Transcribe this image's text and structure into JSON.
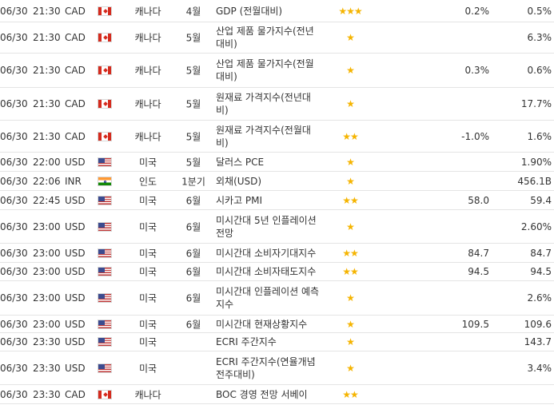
{
  "rows": [
    {
      "date": "06/30",
      "time": "21:30",
      "currency": "CAD",
      "flag": "ca",
      "country": "캐나다",
      "period": "4월",
      "event": "GDP (전월대비)",
      "importance": "★★★",
      "previous": "0.2%",
      "actual": "0.5%"
    },
    {
      "date": "06/30",
      "time": "21:30",
      "currency": "CAD",
      "flag": "ca",
      "country": "캐나다",
      "period": "5월",
      "event": "산업 제품 물가지수(전년대비)",
      "importance": "★",
      "previous": "",
      "actual": "6.3%"
    },
    {
      "date": "06/30",
      "time": "21:30",
      "currency": "CAD",
      "flag": "ca",
      "country": "캐나다",
      "period": "5월",
      "event": "산업 제품 물가지수(전월대비)",
      "importance": "★",
      "previous": "0.3%",
      "actual": "0.6%"
    },
    {
      "date": "06/30",
      "time": "21:30",
      "currency": "CAD",
      "flag": "ca",
      "country": "캐나다",
      "period": "5월",
      "event": "원재료 가격지수(전년대비)",
      "importance": "★",
      "previous": "",
      "actual": "17.7%"
    },
    {
      "date": "06/30",
      "time": "21:30",
      "currency": "CAD",
      "flag": "ca",
      "country": "캐나다",
      "period": "5월",
      "event": "원재료 가격지수(전월대비)",
      "importance": "★★",
      "previous": "-1.0%",
      "actual": "1.6%"
    },
    {
      "date": "06/30",
      "time": "22:00",
      "currency": "USD",
      "flag": "us",
      "country": "미국",
      "period": "5월",
      "event": "달러스 PCE",
      "importance": "★",
      "previous": "",
      "actual": "1.90%"
    },
    {
      "date": "06/30",
      "time": "22:06",
      "currency": "INR",
      "flag": "in",
      "country": "인도",
      "period": "1분기",
      "event": "외채(USD)",
      "importance": "★",
      "previous": "",
      "actual": "456.1B"
    },
    {
      "date": "06/30",
      "time": "22:45",
      "currency": "USD",
      "flag": "us",
      "country": "미국",
      "period": "6월",
      "event": "시카고 PMI",
      "importance": "★★",
      "previous": "58.0",
      "actual": "59.4"
    },
    {
      "date": "06/30",
      "time": "23:00",
      "currency": "USD",
      "flag": "us",
      "country": "미국",
      "period": "6월",
      "event": "미시간대 5년 인플레이션 전망",
      "importance": "★",
      "previous": "",
      "actual": "2.60%"
    },
    {
      "date": "06/30",
      "time": "23:00",
      "currency": "USD",
      "flag": "us",
      "country": "미국",
      "period": "6월",
      "event": "미시간대 소비자기대지수",
      "importance": "★★",
      "previous": "84.7",
      "actual": "84.7"
    },
    {
      "date": "06/30",
      "time": "23:00",
      "currency": "USD",
      "flag": "us",
      "country": "미국",
      "period": "6월",
      "event": "미시간대 소비자태도지수",
      "importance": "★★",
      "previous": "94.5",
      "actual": "94.5"
    },
    {
      "date": "06/30",
      "time": "23:00",
      "currency": "USD",
      "flag": "us",
      "country": "미국",
      "period": "6월",
      "event": "미시간대 인플레이션 예측지수",
      "importance": "★",
      "previous": "",
      "actual": "2.6%"
    },
    {
      "date": "06/30",
      "time": "23:00",
      "currency": "USD",
      "flag": "us",
      "country": "미국",
      "period": "6월",
      "event": "미시간대 현재상황지수",
      "importance": "★",
      "previous": "109.5",
      "actual": "109.6"
    },
    {
      "date": "06/30",
      "time": "23:30",
      "currency": "USD",
      "flag": "us",
      "country": "미국",
      "period": "",
      "event": "ECRI 주간지수",
      "importance": "★",
      "previous": "",
      "actual": "143.7"
    },
    {
      "date": "06/30",
      "time": "23:30",
      "currency": "USD",
      "flag": "us",
      "country": "미국",
      "period": "",
      "event": "ECRI 주간지수(연율개념 전주대비)",
      "importance": "★",
      "previous": "",
      "actual": "3.4%"
    },
    {
      "date": "06/30",
      "time": "23:30",
      "currency": "CAD",
      "flag": "ca",
      "country": "캐나다",
      "period": "",
      "event": "BOC 경영 전망 서베이",
      "importance": "★★",
      "previous": "",
      "actual": ""
    }
  ]
}
